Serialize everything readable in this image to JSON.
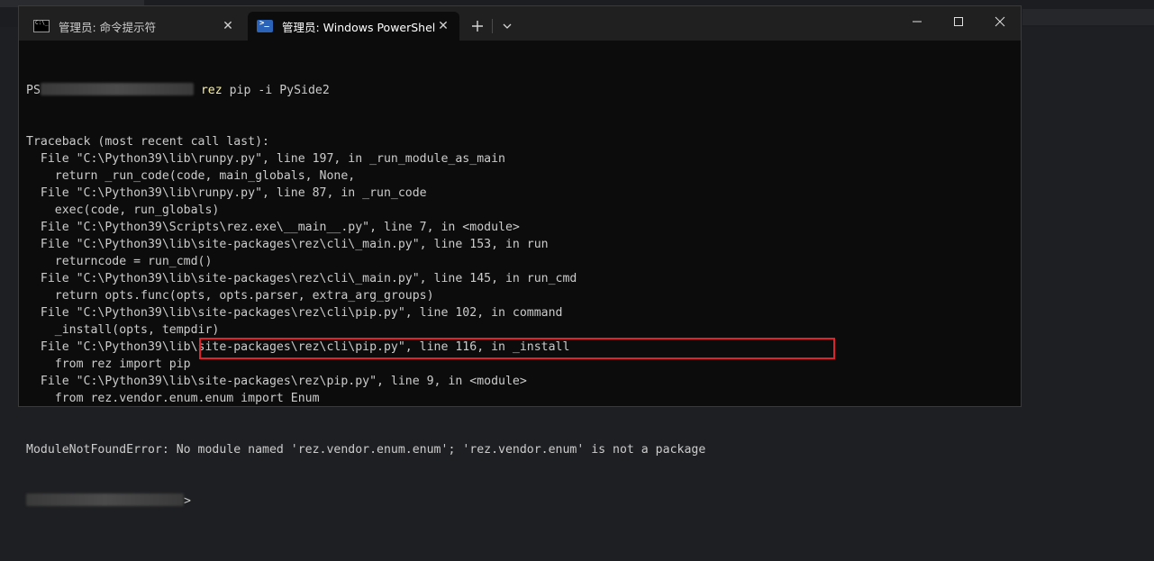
{
  "tabs": [
    {
      "label": "管理员: 命令提示符",
      "icon": "cmd-icon",
      "active": false
    },
    {
      "label": "管理员: Windows PowerShell",
      "icon": "powershell-icon",
      "active": true
    }
  ],
  "tab_actions": {
    "new_tab": "+",
    "dropdown": "⌄"
  },
  "window_controls": {
    "minimize": "—",
    "maximize": "☐",
    "close": "✕"
  },
  "terminal": {
    "prompt_prefix": "PS",
    "command_keyword": "rez",
    "command_rest": " pip -i PySide2",
    "lines": [
      "Traceback (most recent call last):",
      "  File \"C:\\Python39\\lib\\runpy.py\", line 197, in _run_module_as_main",
      "    return _run_code(code, main_globals, None,",
      "  File \"C:\\Python39\\lib\\runpy.py\", line 87, in _run_code",
      "    exec(code, run_globals)",
      "  File \"C:\\Python39\\Scripts\\rez.exe\\__main__.py\", line 7, in <module>",
      "  File \"C:\\Python39\\lib\\site-packages\\rez\\cli\\_main.py\", line 153, in run",
      "    returncode = run_cmd()",
      "  File \"C:\\Python39\\lib\\site-packages\\rez\\cli\\_main.py\", line 145, in run_cmd",
      "    return opts.func(opts, opts.parser, extra_arg_groups)",
      "  File \"C:\\Python39\\lib\\site-packages\\rez\\cli\\pip.py\", line 102, in command",
      "    _install(opts, tempdir)",
      "  File \"C:\\Python39\\lib\\site-packages\\rez\\cli\\pip.py\", line 116, in _install",
      "    from rez import pip",
      "  File \"C:\\Python39\\lib\\site-packages\\rez\\pip.py\", line 9, in <module>",
      "    from rez.vendor.enum.enum import Enum"
    ],
    "error_type": "ModuleNotFoundError:",
    "error_message": " No module named 'rez.vendor.enum.enum'; 'rez.vendor.enum' is not a package",
    "final_prompt_suffix": ">"
  },
  "colors": {
    "highlight": "#e0222a",
    "command": "#f9f1a5",
    "text": "#cccccc",
    "background": "#0c0c0c"
  }
}
